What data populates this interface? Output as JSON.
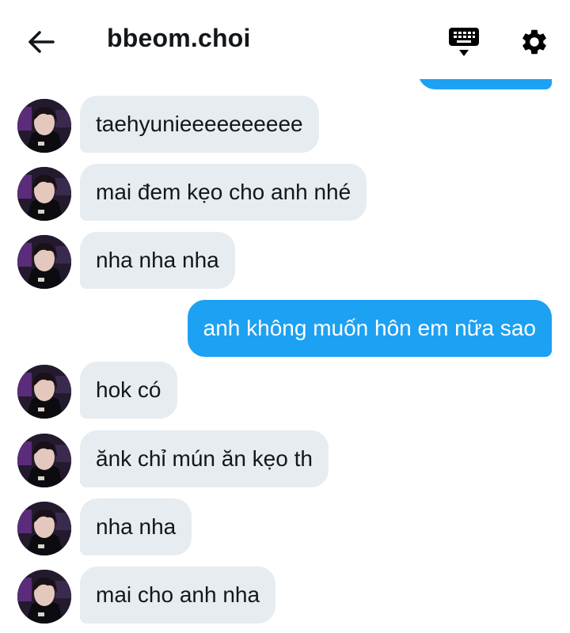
{
  "header": {
    "title": "bbeom.choi",
    "back_icon": "arrow-left-icon",
    "keyboard_icon": "keyboard-icon",
    "settings_icon": "gear-icon"
  },
  "colors": {
    "sent_bubble": "#1da1f2",
    "received_bubble": "#e6ecf0",
    "text_dark": "#14171a"
  },
  "messages": [
    {
      "direction": "in",
      "text": "taehyunieeeeeeeeee"
    },
    {
      "direction": "in",
      "text": "mai đem kẹo cho anh nhé"
    },
    {
      "direction": "in",
      "text": "nha nha nha"
    },
    {
      "direction": "out",
      "text": "anh không muốn hôn em nữa sao"
    },
    {
      "direction": "in",
      "text": "hok có"
    },
    {
      "direction": "in",
      "text": "ănk chỉ mún ăn kẹo th"
    },
    {
      "direction": "in",
      "text": "nha nha"
    },
    {
      "direction": "in",
      "text": "mai cho anh nha"
    }
  ]
}
